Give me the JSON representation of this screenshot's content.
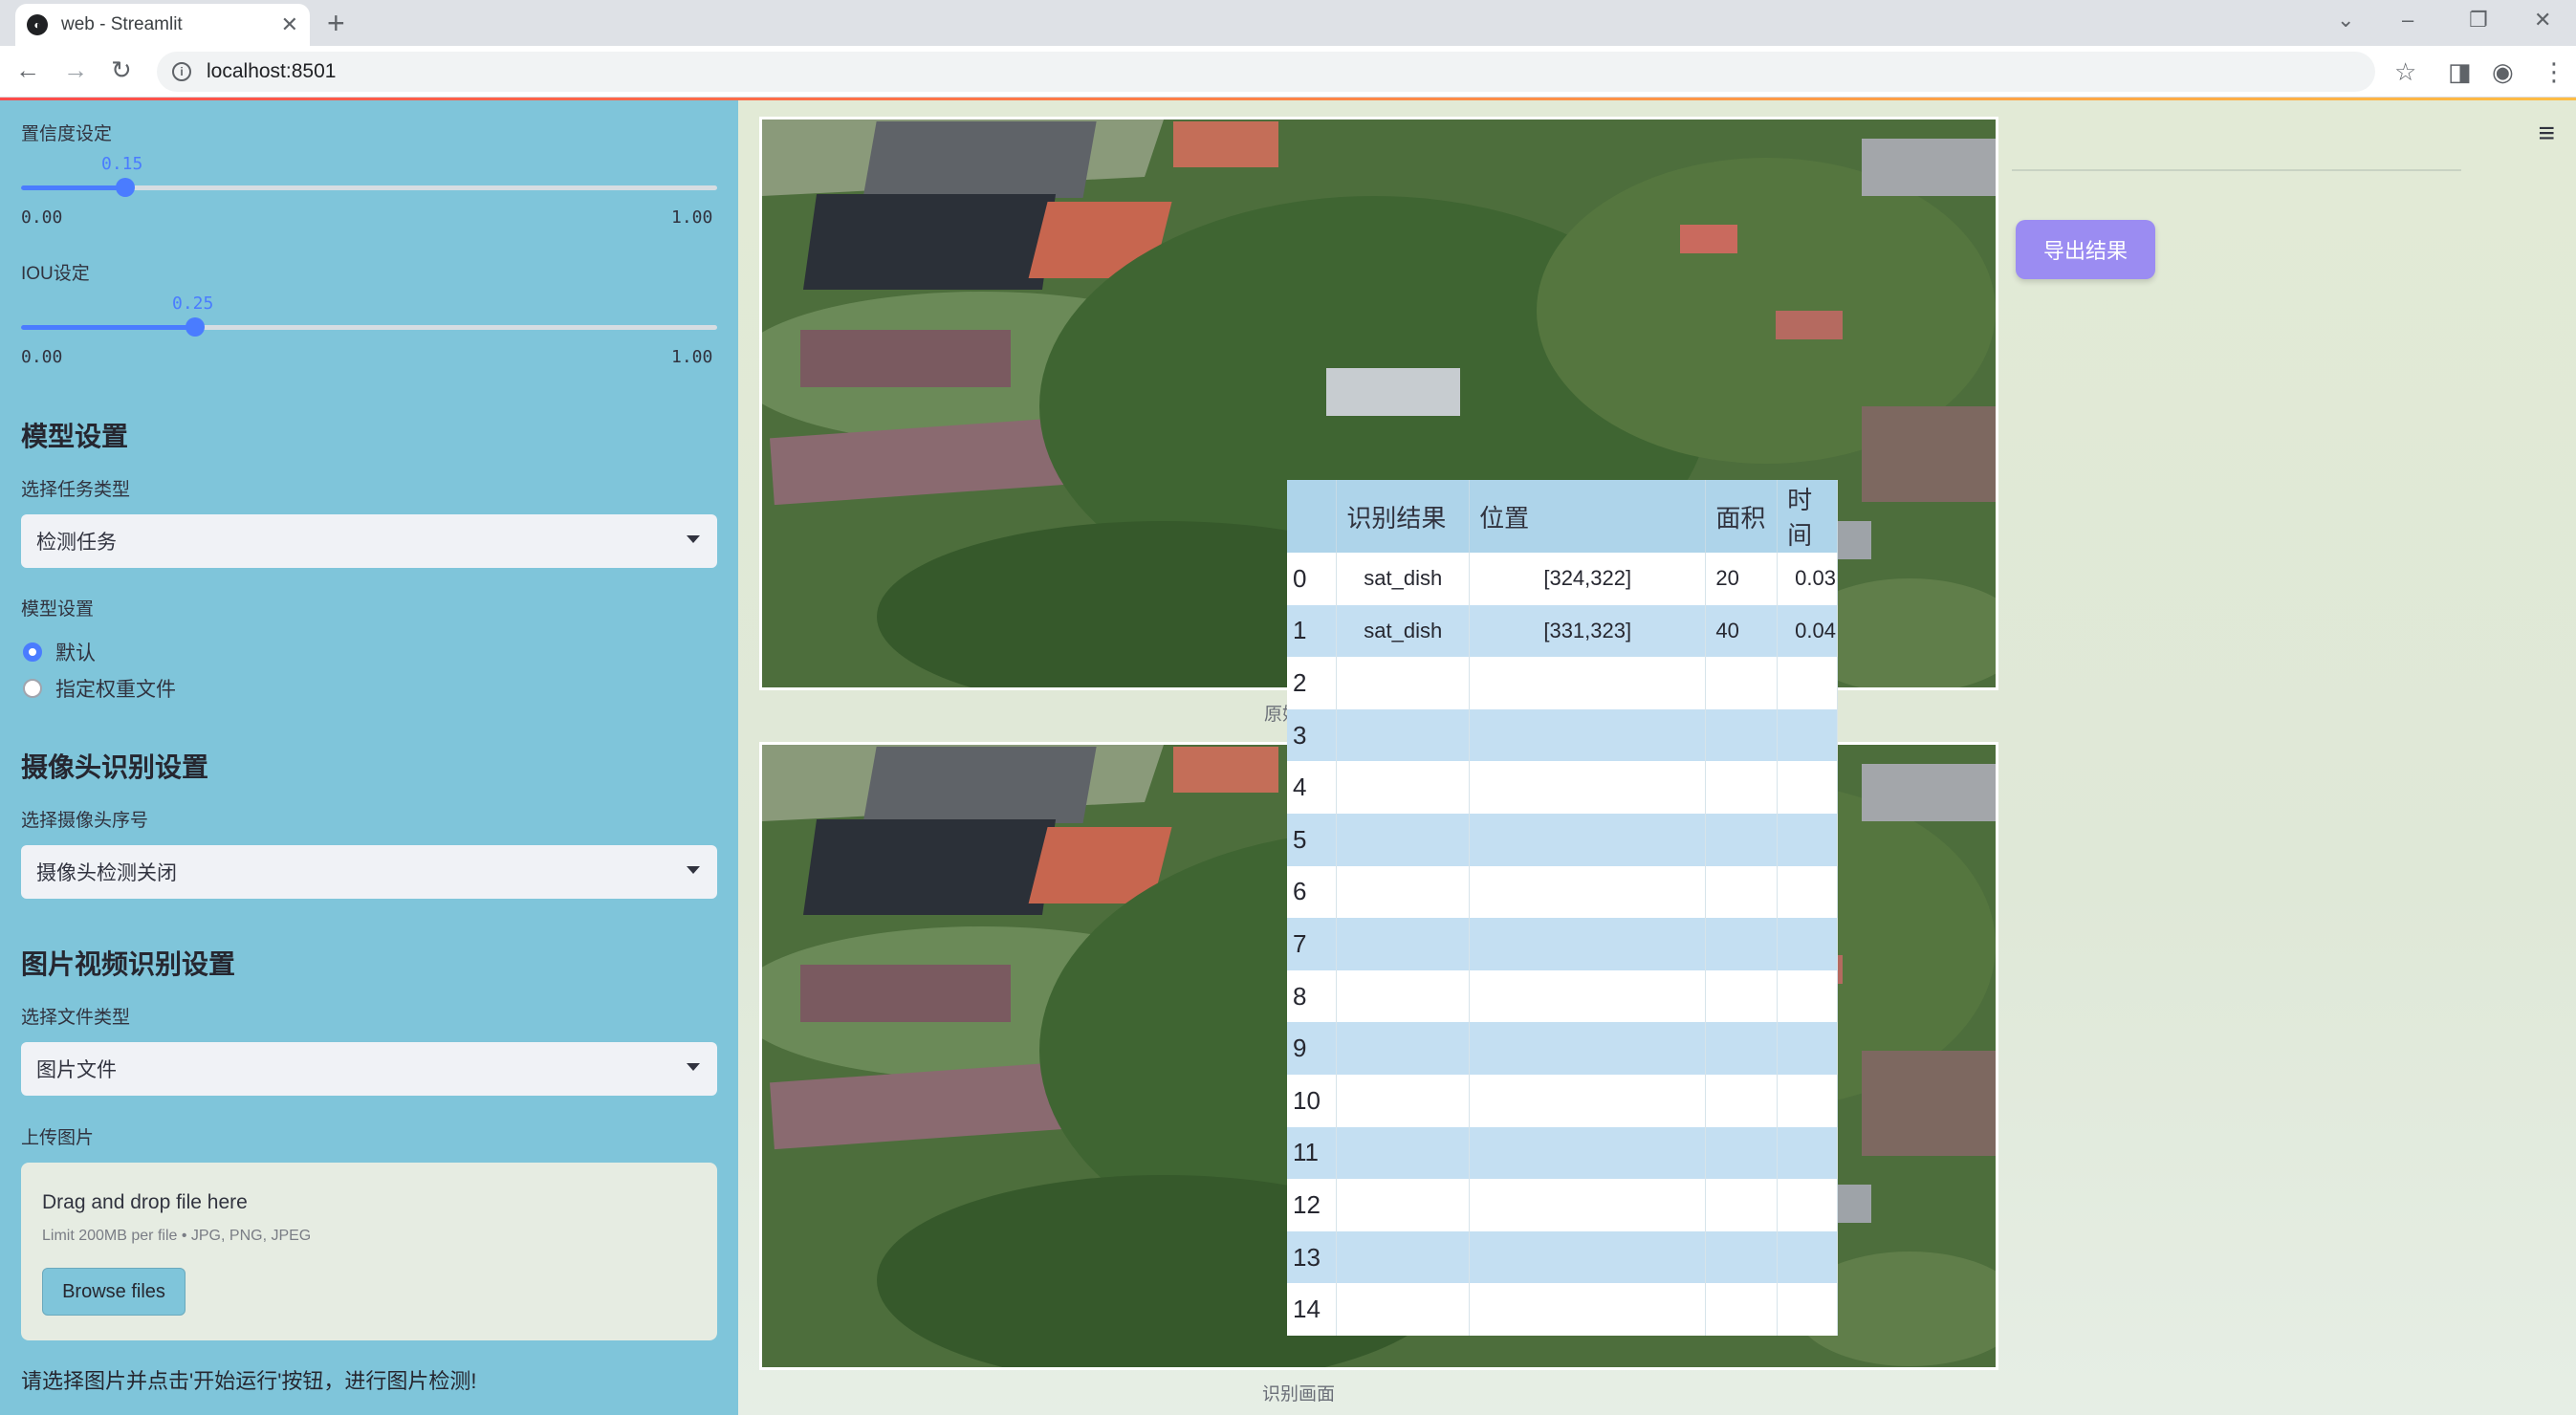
{
  "browser": {
    "tab_title": "web - Streamlit",
    "url": "localhost:8501"
  },
  "sidebar": {
    "confidence": {
      "label": "置信度设定",
      "value": "0.15",
      "value_fraction": 0.15,
      "min": "0.00",
      "max": "1.00"
    },
    "iou": {
      "label": "IOU设定",
      "value": "0.25",
      "value_fraction": 0.25,
      "min": "0.00",
      "max": "1.00"
    },
    "model_section": {
      "title": "模型设置",
      "task_label": "选择任务类型",
      "task_value": "检测任务",
      "model_label": "模型设置",
      "radio_default": "默认",
      "radio_custom": "指定权重文件",
      "selected": "默认"
    },
    "camera_section": {
      "title": "摄像头识别设置",
      "camera_label": "选择摄像头序号",
      "camera_value": "摄像头检测关闭"
    },
    "media_section": {
      "title": "图片视频识别设置",
      "filetype_label": "选择文件类型",
      "filetype_value": "图片文件",
      "upload_label": "上传图片",
      "drop_text": "Drag and drop file here",
      "limit_text": "Limit 200MB per file • JPG, PNG, JPEG",
      "browse_label": "Browse files"
    },
    "note": "请选择图片并点击'开始运行'按钮，进行图片检测!"
  },
  "main": {
    "original_caption": "原始画面",
    "result_caption": "识别画面",
    "detection_label": "sat_dish",
    "export_label": "导出结果"
  },
  "table": {
    "headers": [
      "识别结果",
      "位置",
      "面积",
      "时间"
    ],
    "rows": [
      [
        "0",
        "sat_dish",
        "[324,322]",
        "20",
        "0.03"
      ],
      [
        "1",
        "sat_dish",
        "[331,323]",
        "40",
        "0.04"
      ],
      [
        "2",
        "",
        "",
        "",
        ""
      ],
      [
        "3",
        "",
        "",
        "",
        ""
      ],
      [
        "4",
        "",
        "",
        "",
        ""
      ],
      [
        "5",
        "",
        "",
        "",
        ""
      ],
      [
        "6",
        "",
        "",
        "",
        ""
      ],
      [
        "7",
        "",
        "",
        "",
        ""
      ],
      [
        "8",
        "",
        "",
        "",
        ""
      ],
      [
        "9",
        "",
        "",
        "",
        ""
      ],
      [
        "10",
        "",
        "",
        "",
        ""
      ],
      [
        "11",
        "",
        "",
        "",
        ""
      ],
      [
        "12",
        "",
        "",
        "",
        ""
      ],
      [
        "13",
        "",
        "",
        "",
        ""
      ],
      [
        "14",
        "",
        "",
        "",
        ""
      ]
    ]
  },
  "colors": {
    "sidebar_bg": "#7fc5da",
    "slider_accent": "#4a7cff",
    "export_button": "#9b8cf2",
    "table_header": "#aed4ea",
    "table_alt_row": "#c4dff2",
    "detection_label": "#22e022"
  }
}
